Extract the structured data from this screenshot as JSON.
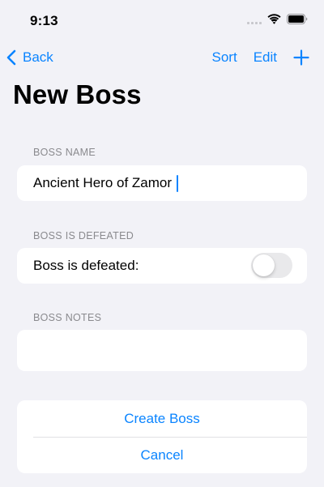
{
  "status_bar": {
    "time": "9:13"
  },
  "nav": {
    "back_label": "Back",
    "sort_label": "Sort",
    "edit_label": "Edit"
  },
  "page": {
    "title": "New Boss"
  },
  "form": {
    "boss_name": {
      "header": "BOSS NAME",
      "value": "Ancient Hero of Zamor"
    },
    "boss_defeated": {
      "header": "BOSS IS DEFEATED",
      "label": "Boss is defeated:",
      "toggle_on": false
    },
    "boss_notes": {
      "header": "BOSS NOTES",
      "value": ""
    }
  },
  "actions": {
    "create_label": "Create Boss",
    "cancel_label": "Cancel"
  },
  "colors": {
    "accent": "#0a84ff",
    "background": "#f2f2f7",
    "card": "#ffffff",
    "section_header": "#8a8a8e",
    "toggle_off": "#e9e9eb"
  }
}
